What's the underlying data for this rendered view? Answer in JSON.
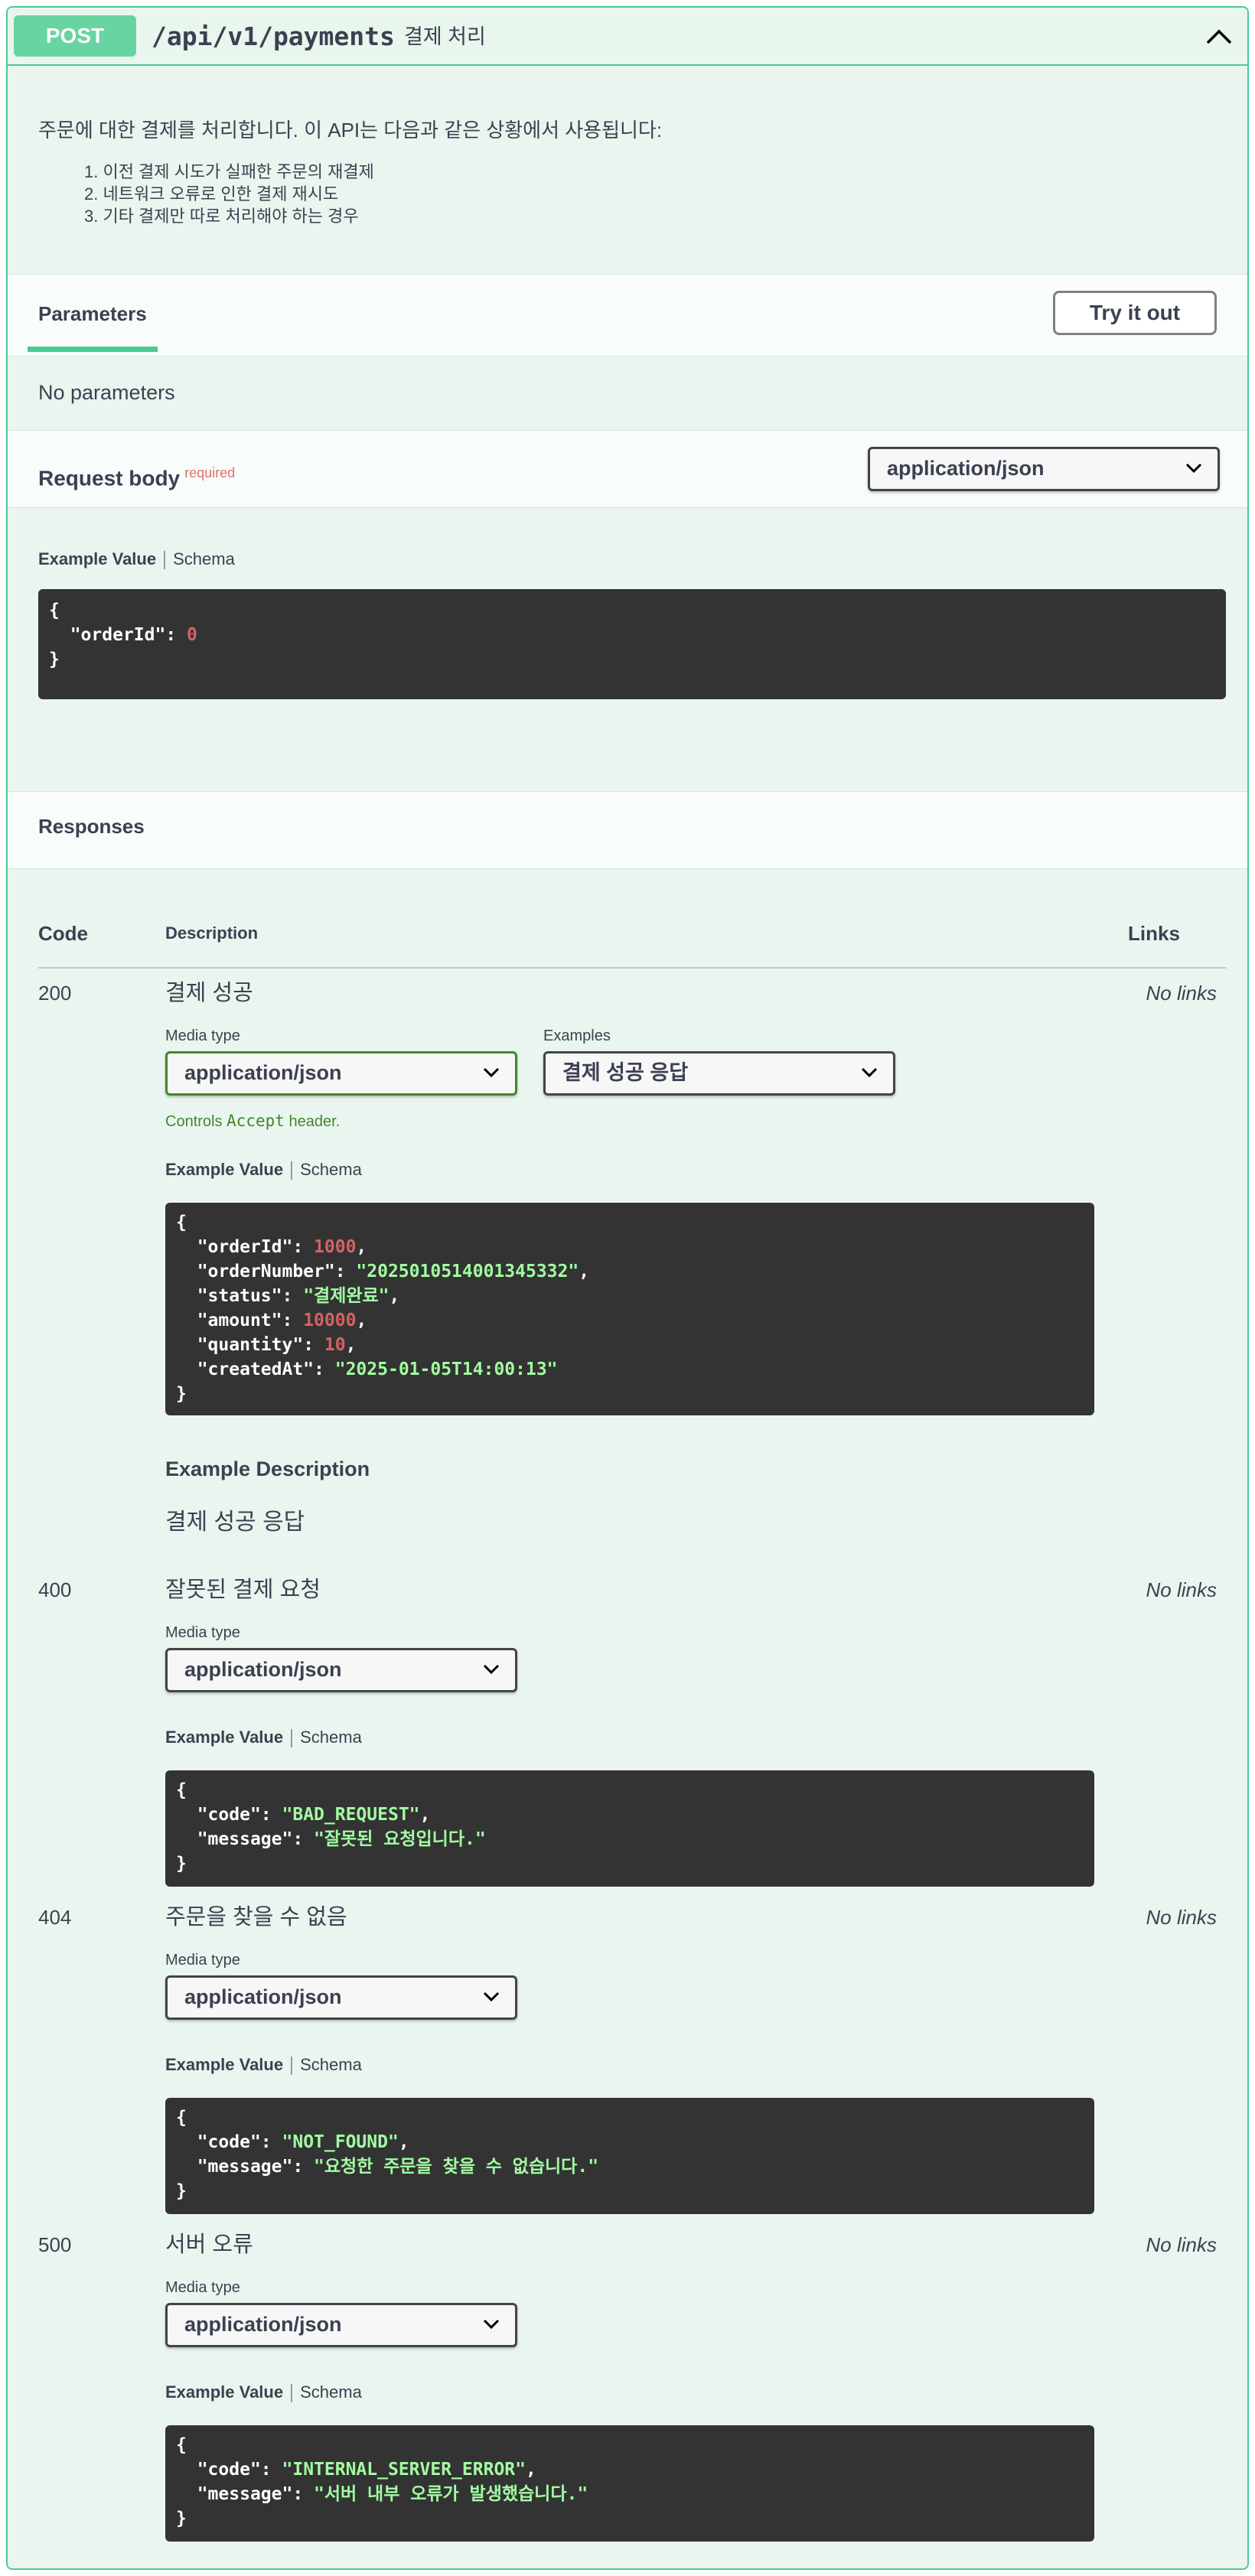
{
  "summary": {
    "method": "POST",
    "path": "/api/v1/payments",
    "description": "결제 처리"
  },
  "description": {
    "intro": "주문에 대한 결제를 처리합니다. 이 API는 다음과 같은 상황에서 사용됩니다:",
    "items": [
      "1. 이전 결제 시도가 실패한 주문의 재결제",
      "2. 네트워크 오류로 인한 결제 재시도",
      "3. 기타 결제만 따로 처리해야 하는 경우"
    ]
  },
  "parameters": {
    "tab_label": "Parameters",
    "try_it_out": "Try it out",
    "no_params": "No parameters"
  },
  "request_body": {
    "label": "Request body",
    "required": "required",
    "content_type": "application/json",
    "example_tab": "Example Value",
    "schema_tab": "Schema",
    "example": {
      "open": "{",
      "key": "\"orderId\"",
      "colon": ": ",
      "value": "0",
      "close": "}"
    }
  },
  "responses": {
    "title": "Responses",
    "headers": {
      "code": "Code",
      "description": "Description",
      "links": "Links"
    },
    "media_type_label": "Media type",
    "examples_label": "Examples",
    "example_tab": "Example Value",
    "schema_tab": "Schema",
    "no_links": "No links",
    "controls_prefix": "Controls ",
    "controls_code": "Accept",
    "controls_suffix": " header.",
    "example_description_title": "Example Description",
    "items": [
      {
        "code": "200",
        "description": "결제 성공",
        "media_type": "application/json",
        "example_select": "결제 성공 응답",
        "example_description": "결제 성공 응답",
        "json": {
          "open": "{",
          "l1k": "\"orderId\"",
          "l1v": "1000",
          "l2k": "\"orderNumber\"",
          "l2v": "\"2025010514001345332\"",
          "l3k": "\"status\"",
          "l3v": "\"결제완료\"",
          "l4k": "\"amount\"",
          "l4v": "10000",
          "l5k": "\"quantity\"",
          "l5v": "10",
          "l6k": "\"createdAt\"",
          "l6v": "\"2025-01-05T14:00:13\"",
          "close": "}"
        }
      },
      {
        "code": "400",
        "description": "잘못된 결제 요청",
        "media_type": "application/json",
        "json": {
          "open": "{",
          "l1k": "\"code\"",
          "l1v": "\"BAD_REQUEST\"",
          "l2k": "\"message\"",
          "l2v": "\"잘못된 요청입니다.\"",
          "close": "}"
        }
      },
      {
        "code": "404",
        "description": "주문을 찾을 수 없음",
        "media_type": "application/json",
        "json": {
          "open": "{",
          "l1k": "\"code\"",
          "l1v": "\"NOT_FOUND\"",
          "l2k": "\"message\"",
          "l2v": "\"요청한 주문을 찾을 수 없습니다.\"",
          "close": "}"
        }
      },
      {
        "code": "500",
        "description": "서버 오류",
        "media_type": "application/json",
        "json": {
          "open": "{",
          "l1k": "\"code\"",
          "l1v": "\"INTERNAL_SERVER_ERROR\"",
          "l2k": "\"message\"",
          "l2v": "\"서버 내부 오류가 발생했습니다.\"",
          "close": "}"
        }
      }
    ]
  },
  "colors": {
    "post_accent": "#49cc90",
    "code_bg": "#333333",
    "number": "#d36363",
    "string": "#a2fca2",
    "required": "#e07070",
    "controls": "#41882c"
  },
  "icons": {
    "collapse": "chevron-up-icon",
    "select": "chevron-down-icon"
  }
}
